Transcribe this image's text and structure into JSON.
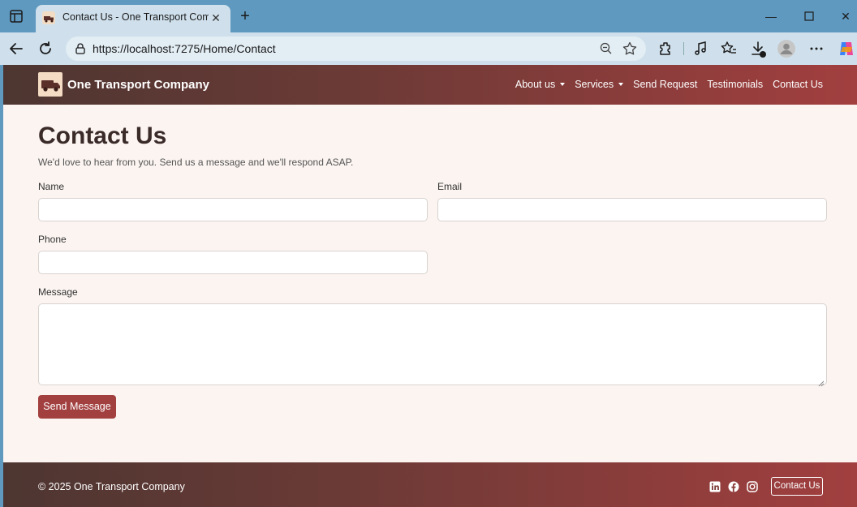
{
  "browser": {
    "tab_title": "Contact Us - One Transport Company",
    "url": "https://localhost:7275/Home/Contact"
  },
  "nav": {
    "brand": "One Transport Company",
    "items": [
      {
        "label": "About us",
        "dropdown": true
      },
      {
        "label": "Services",
        "dropdown": true
      },
      {
        "label": "Send Request",
        "dropdown": false
      },
      {
        "label": "Testimonials",
        "dropdown": false
      },
      {
        "label": "Contact Us",
        "dropdown": false
      }
    ]
  },
  "main": {
    "title": "Contact Us",
    "lead": "We'd love to hear from you. Send us a message and we'll respond ASAP.",
    "fields": {
      "name_label": "Name",
      "email_label": "Email",
      "phone_label": "Phone",
      "message_label": "Message",
      "name_value": "",
      "email_value": "",
      "phone_value": "",
      "message_value": ""
    },
    "submit_label": "Send Message"
  },
  "footer": {
    "copyright": "© 2025 One Transport Company",
    "social": [
      "linkedin-icon",
      "facebook-icon",
      "instagram-icon"
    ],
    "contact_button": "Contact Us"
  },
  "colors": {
    "brand": "#a23f3f",
    "brand_dark": "#4d3631",
    "page_bg": "#fbf4f1",
    "chrome_tabbar": "#5f99bf",
    "chrome_toolbar": "#cfe0ec"
  }
}
